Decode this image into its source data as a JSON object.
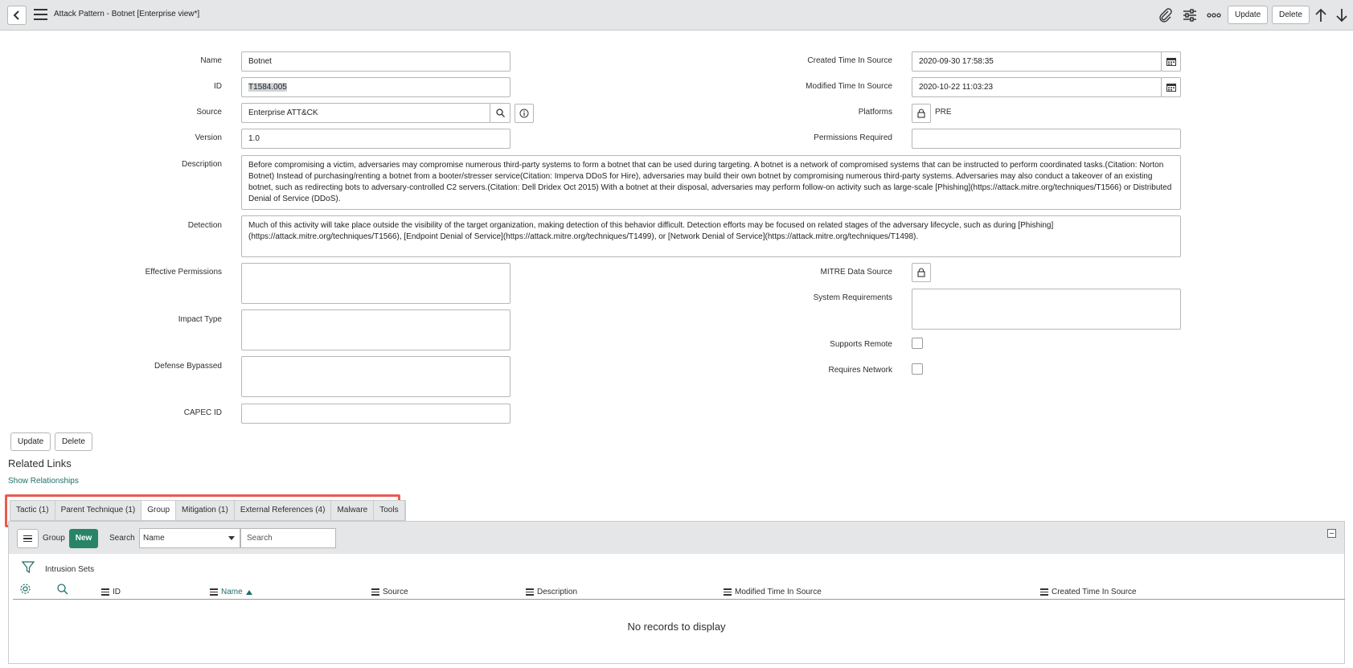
{
  "header": {
    "title": "Attack Pattern - Botnet [Enterprise view*]",
    "update_label": "Update",
    "delete_label": "Delete"
  },
  "form": {
    "name": {
      "label": "Name",
      "value": "Botnet"
    },
    "id": {
      "label": "ID",
      "value": "T1584.005"
    },
    "source": {
      "label": "Source",
      "value": "Enterprise ATT&CK"
    },
    "version": {
      "label": "Version",
      "value": "1.0"
    },
    "description": {
      "label": "Description",
      "value": "Before compromising a victim, adversaries may compromise numerous third-party systems to form a botnet that can be used during targeting. A botnet is a network of compromised systems that can be instructed to perform coordinated tasks.(Citation: Norton Botnet) Instead of purchasing/renting a botnet from a booter/stresser service(Citation: Imperva DDoS for Hire), adversaries may build their own botnet by compromising numerous third-party systems. Adversaries may also conduct a takeover of an existing botnet, such as redirecting bots to adversary-controlled C2 servers.(Citation: Dell Dridex Oct 2015) With a botnet at their disposal, adversaries may perform follow-on activity such as large-scale [Phishing](https://attack.mitre.org/techniques/T1566) or Distributed Denial of Service (DDoS)."
    },
    "detection": {
      "label": "Detection",
      "value": "Much of this activity will take place outside the visibility of the target organization, making detection of this behavior difficult. Detection efforts may be focused on related stages of the adversary lifecycle, such as during [Phishing](https://attack.mitre.org/techniques/T1566), [Endpoint Denial of Service](https://attack.mitre.org/techniques/T1499), or [Network Denial of Service](https://attack.mitre.org/techniques/T1498)."
    },
    "effective_permissions": {
      "label": "Effective Permissions",
      "value": ""
    },
    "impact_type": {
      "label": "Impact Type",
      "value": ""
    },
    "defense_bypassed": {
      "label": "Defense Bypassed",
      "value": ""
    },
    "capec_id": {
      "label": "CAPEC ID",
      "value": ""
    },
    "created_time": {
      "label": "Created Time In Source",
      "value": "2020-09-30 17:58:35"
    },
    "modified_time": {
      "label": "Modified Time In Source",
      "value": "2020-10-22 11:03:23"
    },
    "platforms": {
      "label": "Platforms",
      "value": "PRE"
    },
    "permissions_required": {
      "label": "Permissions Required",
      "value": ""
    },
    "mitre_data_source": {
      "label": "MITRE Data Source"
    },
    "system_requirements": {
      "label": "System Requirements",
      "value": ""
    },
    "supports_remote": {
      "label": "Supports Remote"
    },
    "requires_network": {
      "label": "Requires Network"
    },
    "update_label": "Update",
    "delete_label": "Delete"
  },
  "related_links": {
    "title": "Related Links",
    "show_relationships": "Show Relationships"
  },
  "tabs": [
    {
      "label": "Tactic (1)"
    },
    {
      "label": "Parent Technique (1)"
    },
    {
      "label": "Group",
      "active": true
    },
    {
      "label": "Mitigation (1)"
    },
    {
      "label": "External References (4)"
    },
    {
      "label": "Malware"
    },
    {
      "label": "Tools"
    }
  ],
  "list": {
    "title": "Group",
    "new_label": "New",
    "search_label": "Search",
    "select_value": "Name",
    "search_placeholder": "Search",
    "breadcrumb": "Intrusion Sets",
    "columns": [
      "ID",
      "Name",
      "Source",
      "Description",
      "Modified Time In Source",
      "Created Time In Source"
    ],
    "sorted_column": "Name",
    "empty_message": "No records to display"
  },
  "colors": {
    "accent": "#278467",
    "link": "#1f6f6a",
    "highlight_border": "#ea5a4e"
  }
}
